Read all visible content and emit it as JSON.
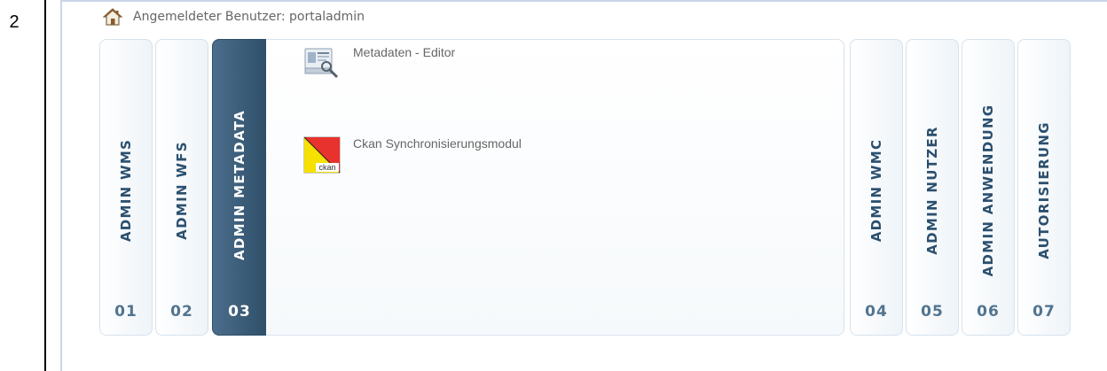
{
  "row_number": "2",
  "header": {
    "icon": "home-icon",
    "user_label": "Angemeldeter Benutzer: portaladmin"
  },
  "tabs": [
    {
      "label": "ADMIN WMS",
      "number": "01",
      "active": false
    },
    {
      "label": "ADMIN WFS",
      "number": "02",
      "active": false
    },
    {
      "label": "ADMIN METADATA",
      "number": "03",
      "active": true
    },
    {
      "label": "ADMIN WMC",
      "number": "04",
      "active": false
    },
    {
      "label": "ADMIN NUTZER",
      "number": "05",
      "active": false
    },
    {
      "label": "ADMIN ANWENDUNG",
      "number": "06",
      "active": false
    },
    {
      "label": "AUTORISIERUNG",
      "number": "07",
      "active": false
    }
  ],
  "panel": {
    "apps": [
      {
        "icon": "metadata-editor-icon",
        "label": "Metadaten - Editor"
      },
      {
        "icon": "ckan-icon",
        "label": "Ckan Synchronisierungsmodul",
        "icon_text": "ckan"
      }
    ]
  },
  "colors": {
    "active_tab": "#3a5d7a",
    "tab_text": "#2b4f6e",
    "tab_number": "#52748f",
    "frame_border": "#c9d6e8",
    "ckan_red": "#e8322d",
    "ckan_yellow": "#f5e000"
  }
}
